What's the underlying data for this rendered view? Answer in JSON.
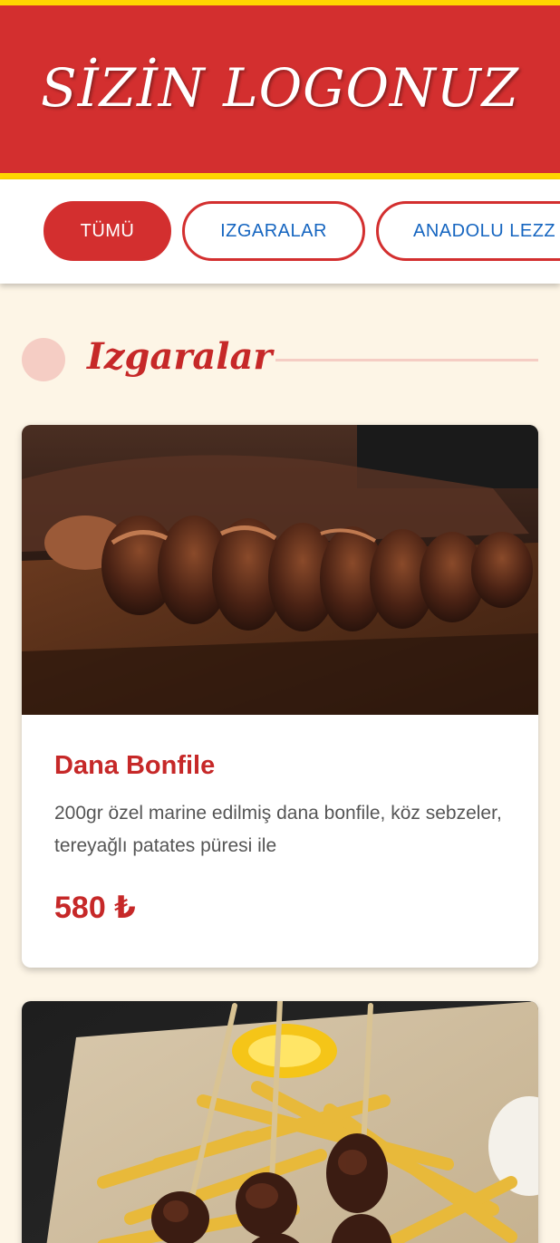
{
  "header": {
    "logo_text": "SİZİN LOGONUZ"
  },
  "nav": {
    "tabs": [
      {
        "label": "TÜMÜ",
        "active": true
      },
      {
        "label": "IZGARALAR",
        "active": false
      },
      {
        "label": "ANADOLU LEZZ",
        "active": false
      }
    ]
  },
  "section": {
    "title": "Izgaralar"
  },
  "menu_items": [
    {
      "name": "Dana Bonfile",
      "description": "200gr özel marine edilmiş dana bonfile, köz sebzeler, tereyağlı patates püresi ile",
      "price": "580 ₺",
      "image": "grilled-steak-photo"
    },
    {
      "image": "skewers-with-fries-photo"
    }
  ],
  "colors": {
    "primary_red": "#d32f2f",
    "accent_yellow": "#ffd600",
    "page_background": "#fdf5e6",
    "tab_text_blue": "#1565c0"
  }
}
